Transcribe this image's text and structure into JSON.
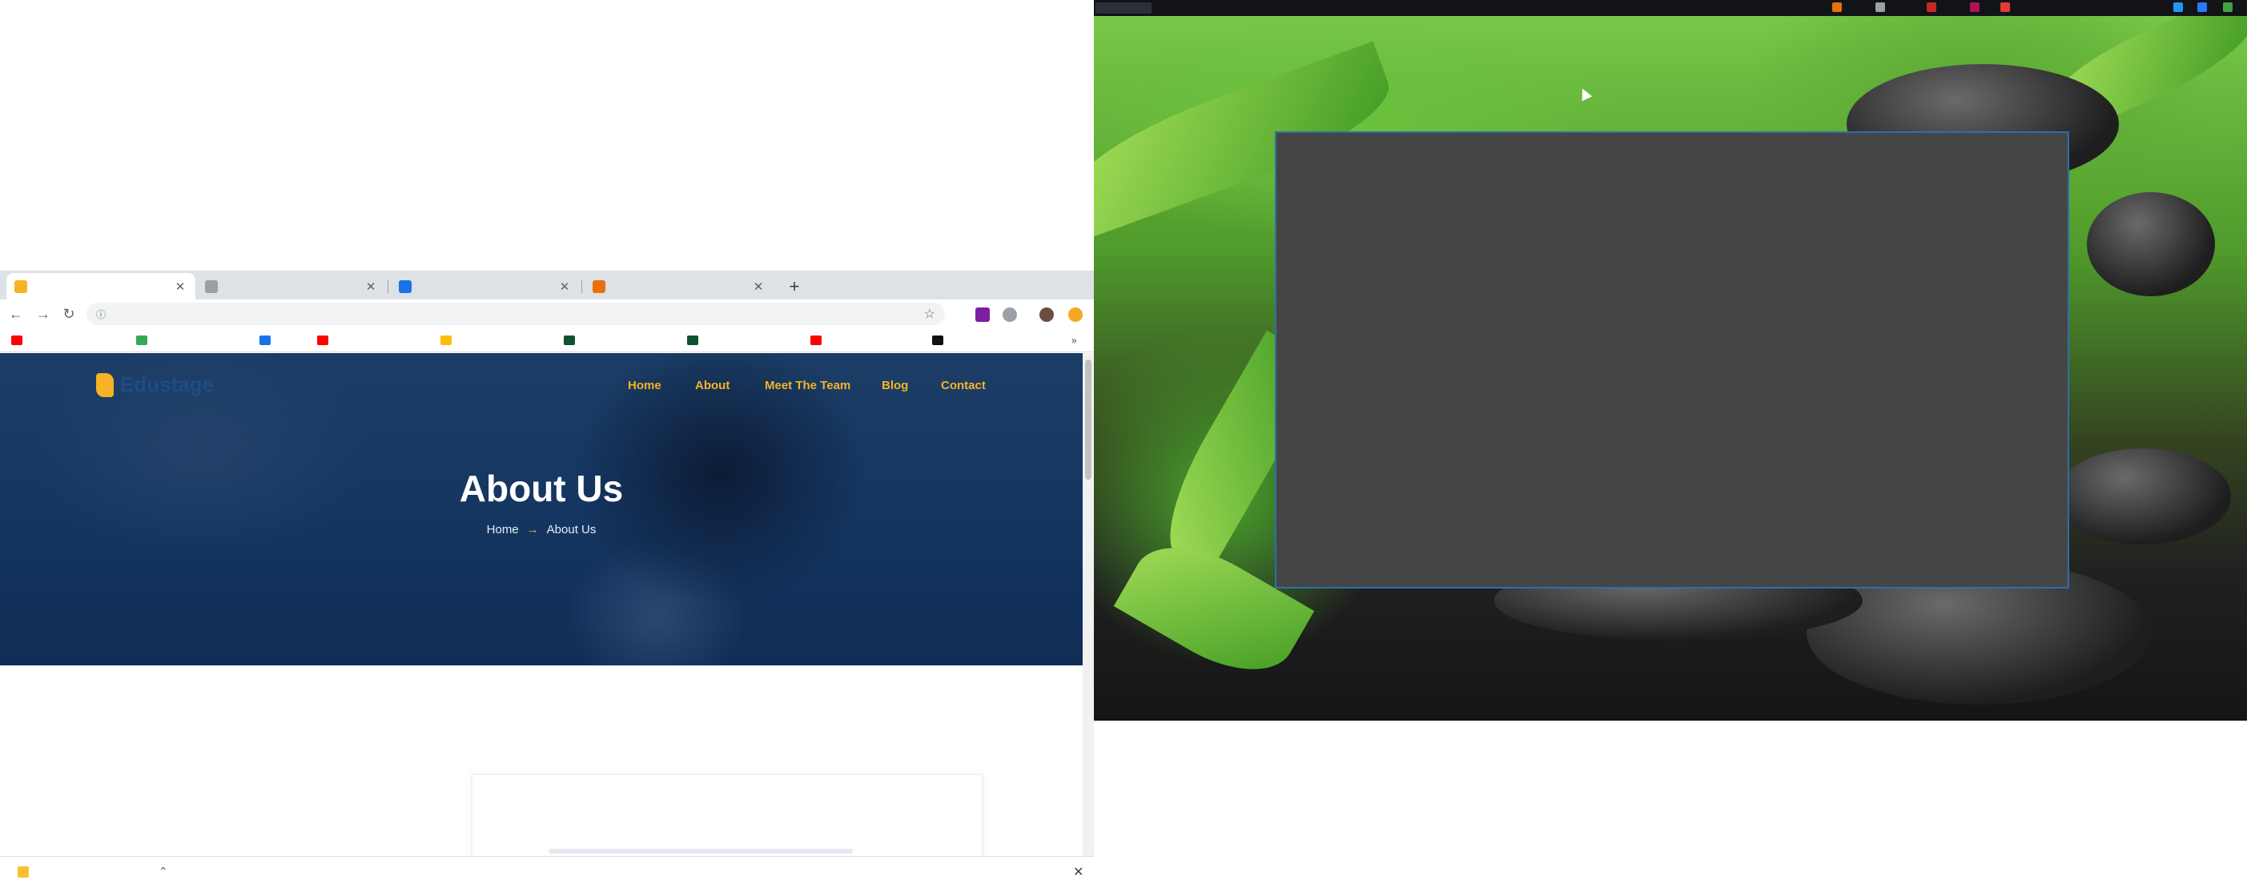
{
  "browser": {
    "tabs": [
      {
        "title": "",
        "favicon_color": "#f5b325",
        "active": true
      },
      {
        "title": "",
        "favicon_color": "#9aa0a6",
        "active": false
      },
      {
        "title": "",
        "favicon_color": "#1a73e8",
        "active": false
      },
      {
        "title": "",
        "favicon_color": "#e8710a",
        "active": false
      }
    ],
    "new_tab_symbol": "+",
    "address": "",
    "bookmarks": [
      {
        "label": "",
        "icon_color": "#ff0000"
      },
      {
        "label": "",
        "icon_color": "#34a853"
      },
      {
        "label": "",
        "icon_color": "#1a73e8"
      },
      {
        "label": "",
        "icon_color": "#ff0000"
      },
      {
        "label": "",
        "icon_color": "#fbbc04"
      },
      {
        "label": "",
        "icon_color": "#0f5132"
      },
      {
        "label": "",
        "icon_color": "#0f5132"
      },
      {
        "label": "",
        "icon_color": "#ff0000"
      },
      {
        "label": "",
        "icon_color": "#111111"
      }
    ],
    "bookmarks_overflow": "»"
  },
  "site": {
    "logo_text": "Edustage",
    "nav": [
      "Home",
      "About",
      "Meet The Team",
      "Blog",
      "Contact"
    ],
    "hero_title": "About Us",
    "breadcrumb": [
      "Home",
      "About Us"
    ],
    "breadcrumb_sep": "→",
    "accent_color": "#f5b325",
    "hero_color": "#143661"
  },
  "download_bar": {
    "file_name": "",
    "show_all": "",
    "close_symbol": "✕"
  },
  "desktop": {
    "corner_label": "",
    "window_color": "#454545"
  }
}
